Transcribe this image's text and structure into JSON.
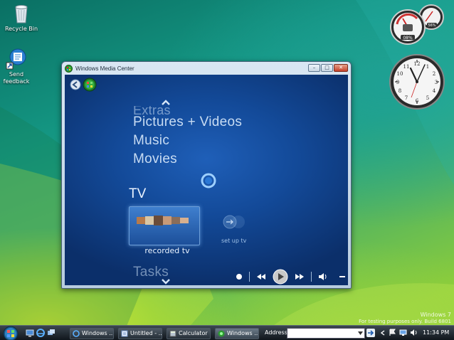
{
  "desktop": {
    "icons": [
      {
        "label": "Recycle Bin",
        "icon": "recycle-bin-icon"
      },
      {
        "label_line1": "Send",
        "label_line2": "feedback",
        "icon": "send-feedback-icon"
      }
    ],
    "watermark_line1": "Windows 7",
    "watermark_line2": "For testing purposes only. Build 6801"
  },
  "gadgets": {
    "meter_cpu_value": "08%",
    "meter_mem_value": "56%"
  },
  "window": {
    "title": "Windows Media Center",
    "menu": {
      "items_above": [
        "Extras",
        "Pictures + Videos",
        "Music",
        "Movies"
      ],
      "current": "TV",
      "item_below": "Tasks",
      "tiles": [
        {
          "label": "recorded tv"
        },
        {
          "label": "set up tv"
        }
      ]
    }
  },
  "taskbar": {
    "buttons": [
      {
        "label": "Windows ...",
        "icon": "ie-icon"
      },
      {
        "label": "Untitled - ...",
        "icon": "notepad-icon"
      },
      {
        "label": "Calculator",
        "icon": "calculator-icon"
      },
      {
        "label": "Windows ...",
        "icon": "media-center-icon"
      }
    ],
    "address_label": "Address",
    "time": "11:34 PM"
  },
  "colors": {
    "wmc_blue": "#134a99",
    "menu_text": "#c8dcf3",
    "taskbar": "#1a222a"
  }
}
